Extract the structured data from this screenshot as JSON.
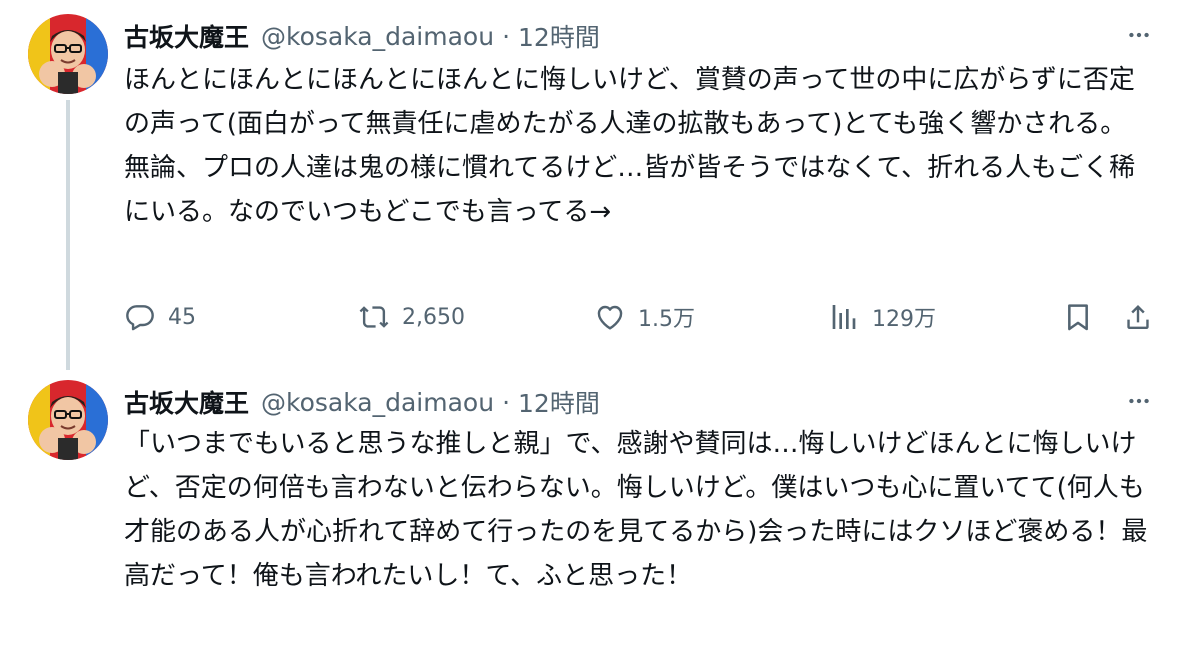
{
  "tweets": [
    {
      "author_name": "古坂大魔王",
      "handle": "@kosaka_daimaou",
      "separator": "·",
      "time": "12時間",
      "paragraphs": [
        "ほんとにほんとにほんとにほんとに悔しいけど、賞賛の声って世の中に広がらずに否定の声って(面白がって無責任に虐めたがる人達の拡散もあって)とても強く響かされる。",
        "無論、プロの人達は鬼の様に慣れてるけど…皆が皆そうではなくて、折れる人もごく稀にいる。なのでいつもどこでも言ってる→"
      ],
      "stats": {
        "replies": "45",
        "retweets": "2,650",
        "likes": "1.5万",
        "views": "129万"
      }
    },
    {
      "author_name": "古坂大魔王",
      "handle": "@kosaka_daimaou",
      "separator": "·",
      "time": "12時間",
      "paragraphs": [
        "「いつまでもいると思うな推しと親」で、感謝や賛同は…悔しいけどほんとに悔しいけど、否定の何倍も言わないと伝わらない。悔しいけど。僕はいつも心に置いてて(何人も才能のある人が心折れて辞めて行ったのを見てるから)会った時にはクソほど褒める！最高だって！俺も言われたいし！て、ふと思った！"
      ]
    }
  ],
  "icons": {
    "more": "more-dots-icon",
    "reply": "reply-bubble-icon",
    "retweet": "retweet-arrows-icon",
    "like": "heart-icon",
    "views": "views-bar-chart-icon",
    "bookmark": "bookmark-icon",
    "share": "share-upload-icon"
  },
  "colors": {
    "text_primary": "#0f1419",
    "text_secondary": "#536471",
    "thread_line": "#cfd9de",
    "avatar_bg": "#d8272d"
  }
}
